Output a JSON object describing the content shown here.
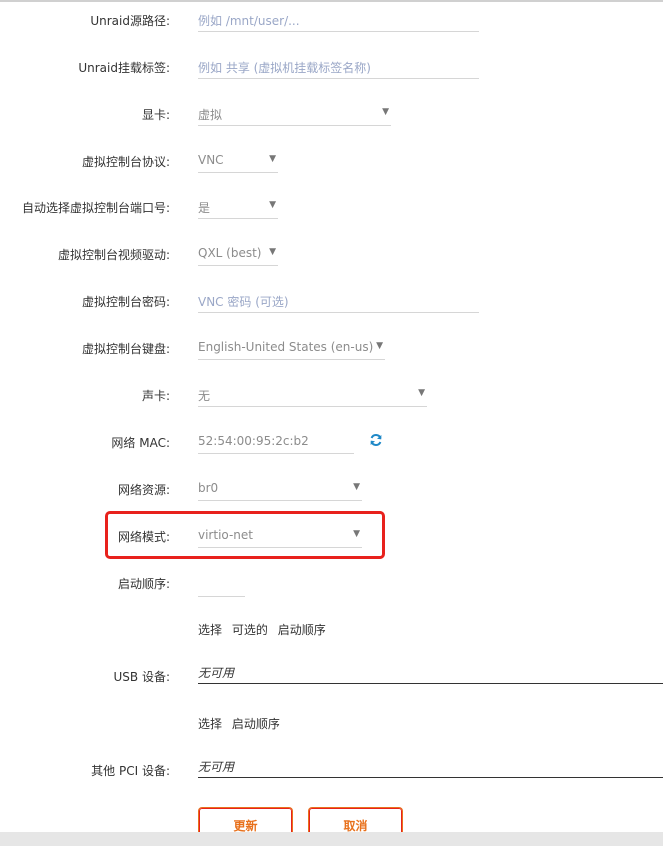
{
  "form": {
    "unraid_path": {
      "label": "Unraid源路径:",
      "placeholder": "例如 /mnt/user/..."
    },
    "unraid_tag": {
      "label": "Unraid挂载标签:",
      "placeholder": "例如 共享 (虚拟机挂载标签名称)"
    },
    "graphics": {
      "label": "显卡:",
      "value": "虚拟"
    },
    "vnc_protocol": {
      "label": "虚拟控制台协议:",
      "value": "VNC"
    },
    "auto_port": {
      "label": "自动选择虚拟控制台端口号:",
      "value": "是"
    },
    "video_driver": {
      "label": "虚拟控制台视频驱动:",
      "value": "QXL (best)"
    },
    "vnc_password": {
      "label": "虚拟控制台密码:",
      "placeholder": "VNC 密码 (可选)"
    },
    "keyboard": {
      "label": "虚拟控制台键盘:",
      "value": "English-United States (en-us)"
    },
    "sound": {
      "label": "声卡:",
      "value": "无"
    },
    "mac": {
      "label": "网络 MAC:",
      "value": "52:54:00:95:2c:b2"
    },
    "network_source": {
      "label": "网络资源:",
      "value": "br0"
    },
    "network_model": {
      "label": "网络模式:",
      "value": "virtio-net"
    },
    "boot_order": {
      "label": "启动顺序:",
      "value": ""
    },
    "usb_hint": {
      "w1": "选择",
      "w2": "可选的",
      "w3": "启动顺序"
    },
    "usb": {
      "label": "USB 设备:",
      "value": "无可用"
    },
    "pci_hint": {
      "w1": "选择",
      "w2": "启动顺序"
    },
    "pci": {
      "label": "其他 PCI 设备:",
      "value": "无可用"
    }
  },
  "buttons": {
    "update": "更新",
    "cancel": "取消"
  },
  "icons": {
    "mac_refresh": "refresh-icon",
    "dropdown": "caret-down-icon"
  },
  "colors": {
    "highlight": "#e8211c",
    "button_accent": "#e8711c",
    "refresh_icon": "#1e88c7"
  }
}
